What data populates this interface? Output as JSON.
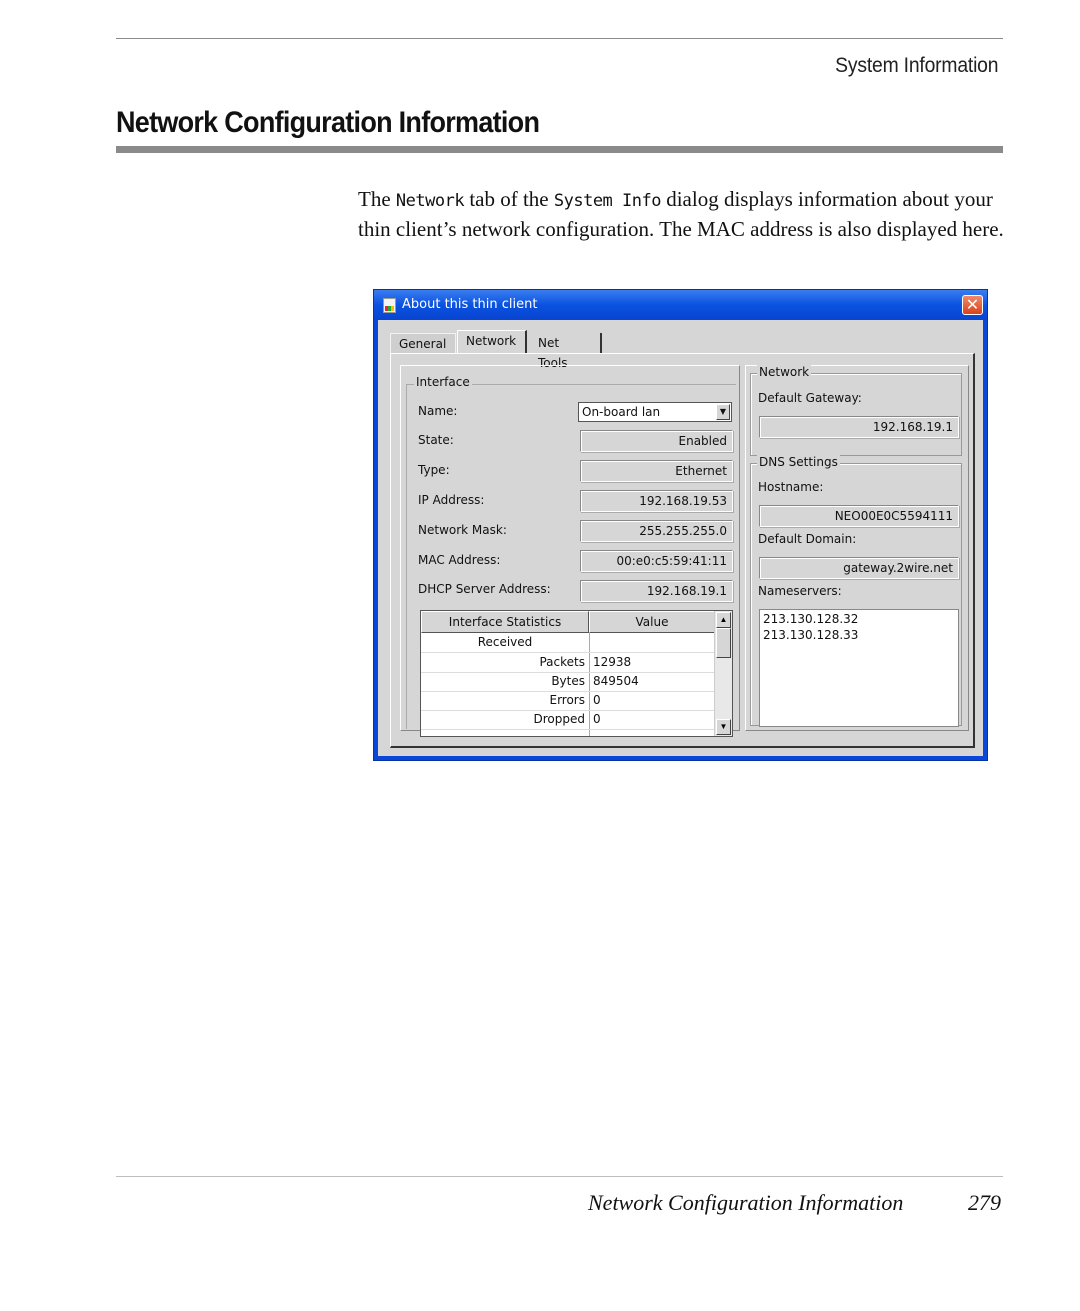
{
  "header": {
    "running_title": "System Information",
    "section_title": "Network Configuration Information"
  },
  "body": {
    "text_1": "The ",
    "code_1": "Network",
    "text_2": " tab of the ",
    "code_2": "System Info",
    "text_3": " dialog displays information about your thin client’s network configuration. The MAC address is also displayed here."
  },
  "dialog": {
    "title": "About this thin client",
    "close_glyph": "✕",
    "tabs": [
      {
        "label": "General",
        "active": false
      },
      {
        "label": "Network",
        "active": true
      },
      {
        "label": "Net Tools",
        "active": false
      }
    ],
    "interface": {
      "group_label": "Interface",
      "name_label": "Name:",
      "name_value": "On-board lan",
      "combo_arrow": "▼",
      "fields": [
        {
          "label": "State:",
          "value": "Enabled"
        },
        {
          "label": "Type:",
          "value": "Ethernet"
        },
        {
          "label": "IP Address:",
          "value": "192.168.19.53"
        },
        {
          "label": "Network Mask:",
          "value": "255.255.255.0"
        },
        {
          "label": "MAC Address:",
          "value": "00:e0:c5:59:41:11"
        },
        {
          "label": "DHCP Server Address:",
          "value": "192.168.19.1"
        }
      ],
      "stats": {
        "headers": [
          "Interface Statistics",
          "Value"
        ],
        "rows": [
          {
            "name": "Received",
            "value": ""
          },
          {
            "name": "Packets",
            "value": "12938"
          },
          {
            "name": "Bytes",
            "value": "849504"
          },
          {
            "name": "Errors",
            "value": "0"
          },
          {
            "name": "Dropped",
            "value": "0"
          }
        ],
        "scroll_up": "▲",
        "scroll_down": "▼"
      }
    },
    "network": {
      "group_label": "Network",
      "gateway_label": "Default Gateway:",
      "gateway_value": "192.168.19.1"
    },
    "dns": {
      "group_label": "DNS Settings",
      "hostname_label": "Hostname:",
      "hostname_value": "NEO00E0C5594111",
      "domain_label": "Default Domain:",
      "domain_value": "gateway.2wire.net",
      "nameservers_label": "Nameservers:",
      "nameservers": [
        "213.130.128.32",
        "213.130.128.33"
      ]
    }
  },
  "footer": {
    "title": "Network Configuration Information",
    "page_number": "279"
  }
}
